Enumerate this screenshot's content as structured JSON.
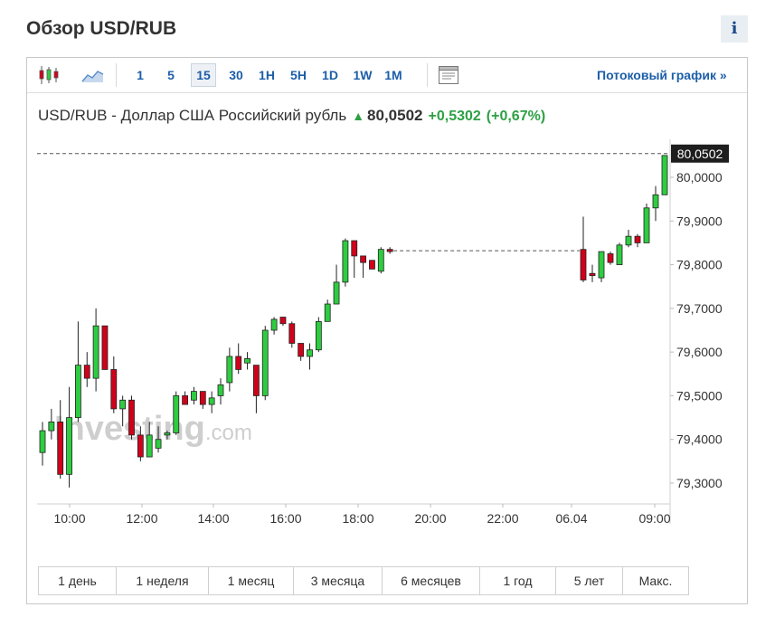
{
  "page": {
    "title": "Обзор USD/RUB",
    "info_label": "i"
  },
  "toolbar": {
    "timeframes": [
      "1",
      "5",
      "15",
      "30",
      "1H",
      "5H",
      "1D",
      "1W",
      "1M"
    ],
    "active_timeframe": "15",
    "stream_label": "Потоковый график »"
  },
  "instrument": {
    "name": "USD/RUB - Доллар США Российский рубль",
    "price": "80,0502",
    "change": "+0,5302",
    "change_pct": "(+0,67%)",
    "direction": "up"
  },
  "colors": {
    "up": "#2ecc40",
    "down": "#d0021b",
    "accent": "#1c5ea8",
    "change_text": "#2ea044"
  },
  "watermark": {
    "brand": "Investing",
    "suffix": ".com"
  },
  "ranges": [
    "1 день",
    "1 неделя",
    "1 месяц",
    "3 месяца",
    "6 месяцев",
    "1 год",
    "5 лет",
    "Макс."
  ],
  "chart_data": {
    "type": "candlestick",
    "y_ticks": [
      79.3,
      79.4,
      79.5,
      79.6,
      79.7,
      79.8,
      79.9,
      80.0
    ],
    "y_tick_labels": [
      "79,3000",
      "79,4000",
      "79,5000",
      "79,6000",
      "79,7000",
      "79,8000",
      "79,9000",
      "80,0000"
    ],
    "ylim": [
      79.27,
      80.08
    ],
    "x_ticks": [
      "10:00",
      "12:00",
      "14:00",
      "16:00",
      "18:00",
      "20:00",
      "22:00",
      "06.04",
      "09:00"
    ],
    "last_price": 80.0502,
    "last_price_label": "80,0502",
    "flat_level": 79.832,
    "candles": [
      {
        "o": 79.37,
        "h": 79.44,
        "l": 79.34,
        "c": 79.42
      },
      {
        "o": 79.42,
        "h": 79.47,
        "l": 79.4,
        "c": 79.44
      },
      {
        "o": 79.44,
        "h": 79.49,
        "l": 79.31,
        "c": 79.32
      },
      {
        "o": 79.32,
        "h": 79.52,
        "l": 79.29,
        "c": 79.45
      },
      {
        "o": 79.45,
        "h": 79.67,
        "l": 79.44,
        "c": 79.57
      },
      {
        "o": 79.57,
        "h": 79.6,
        "l": 79.52,
        "c": 79.54
      },
      {
        "o": 79.54,
        "h": 79.7,
        "l": 79.51,
        "c": 79.66
      },
      {
        "o": 79.66,
        "h": 79.66,
        "l": 79.56,
        "c": 79.56
      },
      {
        "o": 79.56,
        "h": 79.59,
        "l": 79.46,
        "c": 79.47
      },
      {
        "o": 79.47,
        "h": 79.5,
        "l": 79.43,
        "c": 79.49
      },
      {
        "o": 79.49,
        "h": 79.5,
        "l": 79.4,
        "c": 79.41
      },
      {
        "o": 79.41,
        "h": 79.43,
        "l": 79.35,
        "c": 79.36
      },
      {
        "o": 79.36,
        "h": 79.44,
        "l": 79.36,
        "c": 79.41
      },
      {
        "o": 79.38,
        "h": 79.43,
        "l": 79.37,
        "c": 79.4
      },
      {
        "o": 79.41,
        "h": 79.42,
        "l": 79.4,
        "c": 79.415
      },
      {
        "o": 79.415,
        "h": 79.51,
        "l": 79.41,
        "c": 79.5
      },
      {
        "o": 79.5,
        "h": 79.51,
        "l": 79.48,
        "c": 79.48
      },
      {
        "o": 79.49,
        "h": 79.52,
        "l": 79.48,
        "c": 79.51
      },
      {
        "o": 79.51,
        "h": 79.51,
        "l": 79.47,
        "c": 79.48
      },
      {
        "o": 79.48,
        "h": 79.51,
        "l": 79.46,
        "c": 79.495
      },
      {
        "o": 79.5,
        "h": 79.54,
        "l": 79.48,
        "c": 79.525
      },
      {
        "o": 79.53,
        "h": 79.61,
        "l": 79.51,
        "c": 79.59
      },
      {
        "o": 79.59,
        "h": 79.62,
        "l": 79.55,
        "c": 79.56
      },
      {
        "o": 79.575,
        "h": 79.6,
        "l": 79.56,
        "c": 79.585
      },
      {
        "o": 79.57,
        "h": 79.57,
        "l": 79.46,
        "c": 79.5
      },
      {
        "o": 79.5,
        "h": 79.66,
        "l": 79.49,
        "c": 79.65
      },
      {
        "o": 79.65,
        "h": 79.68,
        "l": 79.64,
        "c": 79.675
      },
      {
        "o": 79.68,
        "h": 79.68,
        "l": 79.66,
        "c": 79.665
      },
      {
        "o": 79.665,
        "h": 79.67,
        "l": 79.61,
        "c": 79.62
      },
      {
        "o": 79.62,
        "h": 79.62,
        "l": 79.58,
        "c": 79.59
      },
      {
        "o": 79.59,
        "h": 79.62,
        "l": 79.56,
        "c": 79.605
      },
      {
        "o": 79.605,
        "h": 79.68,
        "l": 79.6,
        "c": 79.67
      },
      {
        "o": 79.67,
        "h": 79.72,
        "l": 79.67,
        "c": 79.71
      },
      {
        "o": 79.71,
        "h": 79.8,
        "l": 79.71,
        "c": 79.76
      },
      {
        "o": 79.76,
        "h": 79.86,
        "l": 79.75,
        "c": 79.855
      },
      {
        "o": 79.855,
        "h": 79.855,
        "l": 79.77,
        "c": 79.82
      },
      {
        "o": 79.82,
        "h": 79.82,
        "l": 79.77,
        "c": 79.805
      },
      {
        "o": 79.81,
        "h": 79.81,
        "l": 79.79,
        "c": 79.79
      },
      {
        "o": 79.785,
        "h": 79.84,
        "l": 79.78,
        "c": 79.835
      },
      {
        "o": 79.835,
        "h": 79.84,
        "l": 79.825,
        "c": 79.83
      },
      {
        "o": 79.835,
        "h": 79.91,
        "l": 79.76,
        "c": 79.765
      },
      {
        "o": 79.78,
        "h": 79.8,
        "l": 79.76,
        "c": 79.775
      },
      {
        "o": 79.77,
        "h": 79.83,
        "l": 79.76,
        "c": 79.83
      },
      {
        "o": 79.825,
        "h": 79.83,
        "l": 79.8,
        "c": 79.805
      },
      {
        "o": 79.8,
        "h": 79.85,
        "l": 79.8,
        "c": 79.845
      },
      {
        "o": 79.845,
        "h": 79.88,
        "l": 79.84,
        "c": 79.865
      },
      {
        "o": 79.865,
        "h": 79.87,
        "l": 79.84,
        "c": 79.85
      },
      {
        "o": 79.85,
        "h": 79.94,
        "l": 79.85,
        "c": 79.93
      },
      {
        "o": 79.93,
        "h": 79.98,
        "l": 79.9,
        "c": 79.96
      },
      {
        "o": 79.96,
        "h": 80.05,
        "l": 79.96,
        "c": 80.05
      }
    ]
  }
}
